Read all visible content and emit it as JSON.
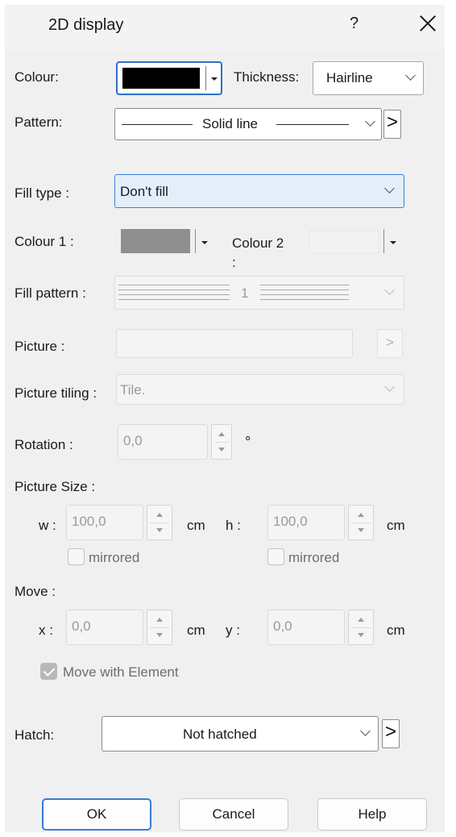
{
  "title": "2D display",
  "help_glyph": "?",
  "line": {
    "colour_label": "Colour:",
    "colour_value": "#000000",
    "thickness_label": "Thickness:",
    "thickness_value": "Hairline",
    "pattern_label": "Pattern:",
    "pattern_value": "Solid line",
    "more_glyph": ">"
  },
  "fill": {
    "type_label": "Fill type :",
    "type_value": "Don't fill",
    "colour1_label": "Colour 1 :",
    "colour1_value": "#8f8f8f",
    "colour2_label_line1": "Colour 2",
    "colour2_label_line2": ":",
    "pattern_label": "Fill pattern :",
    "pattern_value": "1",
    "picture_label": "Picture :",
    "picture_value": "",
    "picture_more_glyph": ">",
    "tiling_label": "Picture tiling :",
    "tiling_value": "Tile.",
    "rotation_label": "Rotation :",
    "rotation_value": "0,0",
    "rotation_unit": "°"
  },
  "size": {
    "heading": "Picture Size :",
    "w_label": "w :",
    "w_value": "100,0",
    "w_unit": "cm",
    "w_mirrored": "mirrored",
    "h_label": "h :",
    "h_value": "100,0",
    "h_unit": "cm",
    "h_mirrored": "mirrored"
  },
  "move": {
    "heading": "Move :",
    "x_label": "x :",
    "x_value": "0,0",
    "x_unit": "cm",
    "y_label": "y :",
    "y_value": "0,0",
    "y_unit": "cm",
    "with_element": "Move with Element",
    "with_element_checked": true
  },
  "hatch": {
    "label": "Hatch:",
    "value": "Not hatched",
    "more_glyph": ">"
  },
  "buttons": {
    "ok": "OK",
    "cancel": "Cancel",
    "help": "Help"
  }
}
